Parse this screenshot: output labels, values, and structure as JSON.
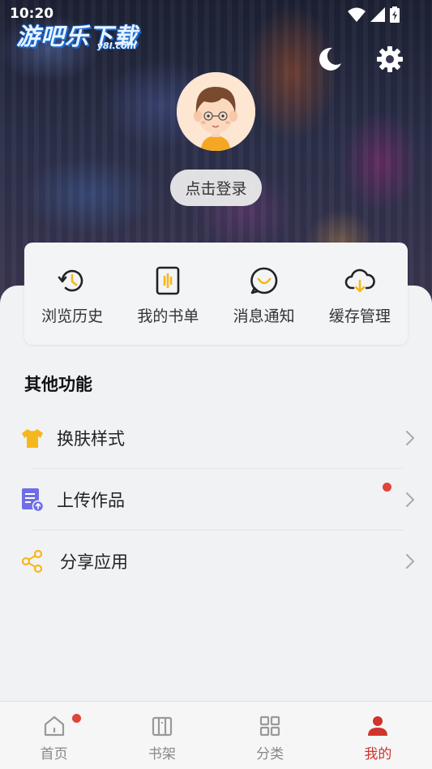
{
  "status_bar": {
    "time": "10:20",
    "icons": [
      "wifi-icon",
      "signal-icon",
      "battery-icon"
    ]
  },
  "watermark": {
    "main": "游吧乐下载",
    "sub": "y8l.com"
  },
  "header": {
    "login_label": "点击登录",
    "icons": [
      "moon-icon",
      "gear-icon"
    ]
  },
  "quick_actions": [
    {
      "label": "浏览历史",
      "icon": "history-icon"
    },
    {
      "label": "我的书单",
      "icon": "booklist-icon"
    },
    {
      "label": "消息通知",
      "icon": "message-icon"
    },
    {
      "label": "缓存管理",
      "icon": "cloud-download-icon"
    }
  ],
  "section_title": "其他功能",
  "menu": [
    {
      "label": "换肤样式",
      "icon": "tshirt-icon",
      "has_dot": false
    },
    {
      "label": "上传作品",
      "icon": "upload-doc-icon",
      "has_dot": true
    },
    {
      "label": "分享应用",
      "icon": "share-icon",
      "has_dot": false
    }
  ],
  "bottom_nav": [
    {
      "label": "首页",
      "icon": "home-icon",
      "has_dot": true,
      "active": false
    },
    {
      "label": "书架",
      "icon": "bookshelf-icon",
      "has_dot": false,
      "active": false
    },
    {
      "label": "分类",
      "icon": "grid-icon",
      "has_dot": false,
      "active": false
    },
    {
      "label": "我的",
      "icon": "user-icon",
      "has_dot": false,
      "active": true
    }
  ],
  "colors": {
    "accent": "#d0342c",
    "icon_yellow": "#f5b81c",
    "icon_purple": "#6f6ee6",
    "dot_red": "#e0443a"
  }
}
